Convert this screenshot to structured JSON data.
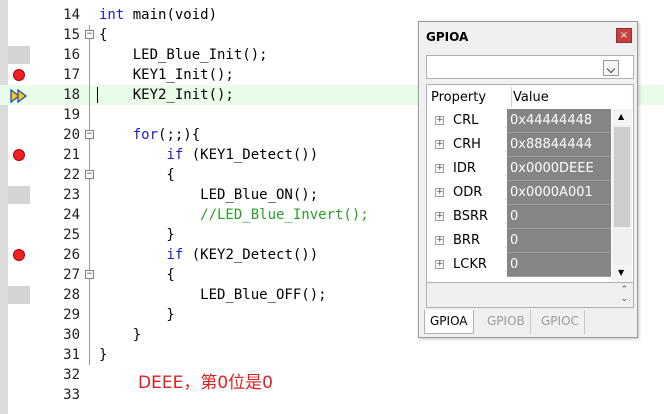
{
  "editor": {
    "lines": [
      {
        "n": "14",
        "code": [
          {
            "t": "int",
            "c": "kw"
          },
          {
            "t": " main(void)",
            "c": ""
          }
        ],
        "fold": "",
        "marker": ""
      },
      {
        "n": "15",
        "code": [
          {
            "t": "{",
            "c": ""
          }
        ],
        "fold": "box",
        "marker": ""
      },
      {
        "n": "16",
        "code": [
          {
            "t": "    LED_Blue_Init();",
            "c": ""
          }
        ],
        "fold": "line",
        "marker": "gray"
      },
      {
        "n": "17",
        "code": [
          {
            "t": "    KEY1_Init();",
            "c": ""
          }
        ],
        "fold": "line",
        "marker": "breakpoint"
      },
      {
        "n": "18",
        "code": [
          {
            "t": "    KEY2_Init();",
            "c": ""
          }
        ],
        "fold": "line",
        "marker": "current-arrow"
      },
      {
        "n": "19",
        "code": [
          {
            "t": "",
            "c": ""
          }
        ],
        "fold": "line",
        "marker": ""
      },
      {
        "n": "20",
        "code": [
          {
            "t": "    ",
            "c": ""
          },
          {
            "t": "for",
            "c": "kw"
          },
          {
            "t": "(;;){",
            "c": ""
          }
        ],
        "fold": "box",
        "marker": ""
      },
      {
        "n": "21",
        "code": [
          {
            "t": "        ",
            "c": ""
          },
          {
            "t": "if",
            "c": "kw"
          },
          {
            "t": " (KEY1_Detect())",
            "c": ""
          }
        ],
        "fold": "line",
        "marker": "breakpoint"
      },
      {
        "n": "22",
        "code": [
          {
            "t": "        {",
            "c": ""
          }
        ],
        "fold": "box",
        "marker": ""
      },
      {
        "n": "23",
        "code": [
          {
            "t": "            LED_Blue_ON();",
            "c": ""
          }
        ],
        "fold": "line",
        "marker": "gray"
      },
      {
        "n": "24",
        "code": [
          {
            "t": "            //LED_Blue_Invert();",
            "c": "cm"
          }
        ],
        "fold": "line",
        "marker": ""
      },
      {
        "n": "25",
        "code": [
          {
            "t": "        }",
            "c": ""
          }
        ],
        "fold": "line",
        "marker": ""
      },
      {
        "n": "26",
        "code": [
          {
            "t": "        ",
            "c": ""
          },
          {
            "t": "if",
            "c": "kw"
          },
          {
            "t": " (KEY2_Detect())",
            "c": ""
          }
        ],
        "fold": "line",
        "marker": "breakpoint"
      },
      {
        "n": "27",
        "code": [
          {
            "t": "        {",
            "c": ""
          }
        ],
        "fold": "box",
        "marker": ""
      },
      {
        "n": "28",
        "code": [
          {
            "t": "            LED_Blue_OFF();",
            "c": ""
          }
        ],
        "fold": "line",
        "marker": "gray"
      },
      {
        "n": "29",
        "code": [
          {
            "t": "        }",
            "c": ""
          }
        ],
        "fold": "line",
        "marker": ""
      },
      {
        "n": "30",
        "code": [
          {
            "t": "    }",
            "c": ""
          }
        ],
        "fold": "line",
        "marker": ""
      },
      {
        "n": "31",
        "code": [
          {
            "t": "}",
            "c": ""
          }
        ],
        "fold": "line",
        "marker": ""
      },
      {
        "n": "32",
        "code": [
          {
            "t": "",
            "c": ""
          }
        ],
        "fold": "",
        "marker": ""
      },
      {
        "n": "33",
        "code": [
          {
            "t": "",
            "c": ""
          }
        ],
        "fold": "",
        "marker": ""
      }
    ],
    "current_line": "18",
    "annotation": "DEEE，第0位是0"
  },
  "gpio_window": {
    "title": "GPIOA",
    "close_glyph": "×",
    "dropdown_value": "",
    "headers": {
      "property": "Property",
      "value": "Value"
    },
    "registers": [
      {
        "name": "CRL",
        "value": "0x44444448"
      },
      {
        "name": "CRH",
        "value": "0x88844444"
      },
      {
        "name": "IDR",
        "value": "0x0000DEEE"
      },
      {
        "name": "ODR",
        "value": "0x0000A001"
      },
      {
        "name": "BSRR",
        "value": "0"
      },
      {
        "name": "BRR",
        "value": "0"
      },
      {
        "name": "LCKR",
        "value": "0"
      }
    ],
    "tabs": [
      {
        "label": "GPIOA",
        "active": true
      },
      {
        "label": "GPIOB",
        "active": false
      },
      {
        "label": "GPIOC",
        "active": false
      }
    ]
  },
  "colors": {
    "keyword": "#1e1ec8",
    "comment": "#2c9c2c",
    "breakpoint": "#e22222",
    "annotation": "#e02020",
    "value_cell": "#858585"
  },
  "icons": {
    "breakpoint": "breakpoint-icon",
    "current": "execution-arrow-icon",
    "close": "close-icon",
    "expander": "plus-expander-icon"
  }
}
